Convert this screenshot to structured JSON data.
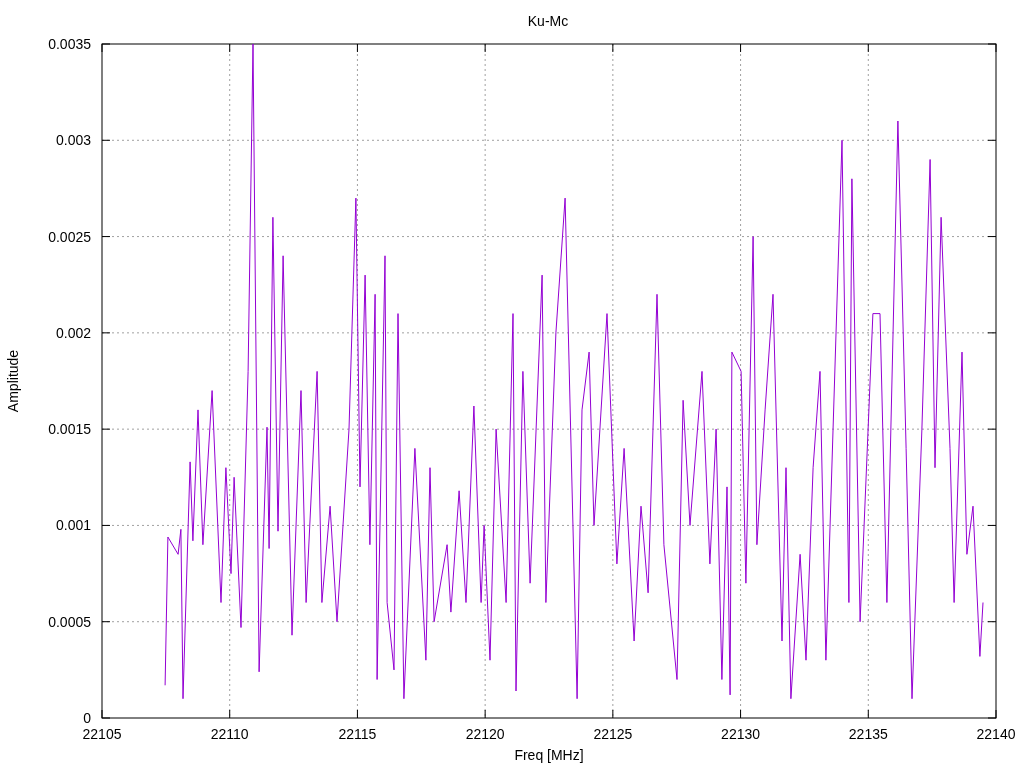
{
  "chart_data": {
    "type": "line",
    "grid": true,
    "title": "Ku-Mc",
    "xlabel": "Freq [MHz]",
    "ylabel": "Amplitude",
    "x": [
      22107.47,
      22107.58,
      22107.98,
      22108.09,
      22108.17,
      22108.45,
      22108.56,
      22108.76,
      22108.95,
      22109.31,
      22109.66,
      22109.85,
      22110.05,
      22110.17,
      22110.44,
      22110.72,
      22110.91,
      22111.15,
      22111.46,
      22111.54,
      22111.69,
      22111.89,
      22112.09,
      22112.44,
      22112.79,
      22112.99,
      22113.42,
      22113.61,
      22113.93,
      22114.2,
      22114.67,
      22114.94,
      22115.1,
      22115.3,
      22115.49,
      22115.69,
      22115.77,
      22116.08,
      22116.16,
      22116.43,
      22116.59,
      22116.82,
      22117.25,
      22117.68,
      22117.84,
      22118.0,
      22118.51,
      22118.66,
      22118.98,
      22119.25,
      22119.56,
      22119.84,
      22119.96,
      22120.19,
      22120.43,
      22120.82,
      22121.09,
      22121.21,
      22121.48,
      22121.76,
      22122.23,
      22122.38,
      22122.77,
      22123.13,
      22123.6,
      22123.79,
      22124.07,
      22124.26,
      22124.77,
      22125.16,
      22125.44,
      22125.83,
      22126.1,
      22126.38,
      22126.73,
      22127.0,
      22127.51,
      22127.75,
      22128.02,
      22128.49,
      22128.8,
      22129.04,
      22129.27,
      22129.47,
      22129.59,
      22129.66,
      22130.02,
      22130.21,
      22130.49,
      22130.64,
      22130.96,
      22131.27,
      22131.62,
      22131.78,
      22131.97,
      22132.33,
      22132.56,
      22132.84,
      22133.11,
      22133.34,
      22133.97,
      22134.24,
      22134.36,
      22134.68,
      22135.18,
      22135.46,
      22135.73,
      22136.16,
      22136.48,
      22136.71,
      22137.1,
      22137.42,
      22137.61,
      22137.85,
      22138.2,
      22138.36,
      22138.67,
      22138.86,
      22139.1,
      22139.37,
      22139.49
    ],
    "series": [
      {
        "color": "#9400d3",
        "values": [
          0.00017,
          0.00094,
          0.00085,
          0.00098,
          0.0001,
          0.00133,
          0.00092,
          0.0016,
          0.0009,
          0.0017,
          0.0006,
          0.0013,
          0.00075,
          0.00125,
          0.00047,
          0.0018,
          0.0035,
          0.00024,
          0.00151,
          0.00088,
          0.0026,
          0.00097,
          0.0024,
          0.00043,
          0.0017,
          0.0006,
          0.0018,
          0.0006,
          0.0011,
          0.0005,
          0.0015,
          0.0027,
          0.0012,
          0.0023,
          0.0009,
          0.0022,
          0.0002,
          0.0024,
          0.0006,
          0.00025,
          0.0021,
          0.0001,
          0.0014,
          0.0003,
          0.0013,
          0.0005,
          0.0009,
          0.00055,
          0.00118,
          0.0006,
          0.00162,
          0.0006,
          0.001,
          0.0003,
          0.0015,
          0.0006,
          0.0021,
          0.00014,
          0.0018,
          0.0007,
          0.0023,
          0.0006,
          0.002,
          0.0027,
          0.0001,
          0.0016,
          0.0019,
          0.001,
          0.0021,
          0.0008,
          0.0014,
          0.0004,
          0.0011,
          0.00065,
          0.0022,
          0.0009,
          0.0002,
          0.00165,
          0.001,
          0.0018,
          0.0008,
          0.0015,
          0.0002,
          0.0012,
          0.00012,
          0.0019,
          0.0018,
          0.0007,
          0.0025,
          0.0009,
          0.0016,
          0.0022,
          0.0004,
          0.0013,
          0.0001,
          0.00085,
          0.0003,
          0.0013,
          0.0018,
          0.0003,
          0.003,
          0.0006,
          0.0028,
          0.0005,
          0.0021,
          0.0021,
          0.0006,
          0.0031,
          0.0014,
          0.0001,
          0.0015,
          0.0029,
          0.0013,
          0.0026,
          0.0014,
          0.0006,
          0.0019,
          0.00085,
          0.0011,
          0.00032,
          0.0006
        ]
      }
    ],
    "xlim": [
      22105,
      22140
    ],
    "ylim": [
      0,
      0.0035
    ],
    "xticks": [
      22105,
      22110,
      22115,
      22120,
      22125,
      22130,
      22135,
      22140
    ],
    "yticks": [
      0,
      0.0005,
      0.001,
      0.0015,
      0.002,
      0.0025,
      0.003,
      0.0035
    ]
  }
}
